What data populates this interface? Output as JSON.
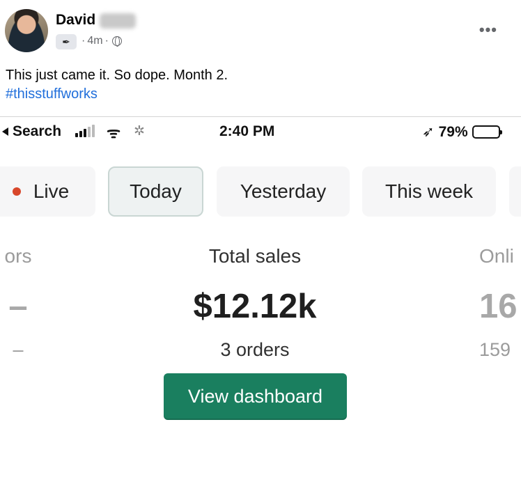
{
  "post": {
    "author": "David",
    "time": "4m",
    "separator": "·",
    "text": "This just came it. So dope. Month 2.",
    "hashtag": "#thisstuffworks",
    "more": "•••"
  },
  "phone": {
    "status": {
      "back_label": "Search",
      "time": "2:40 PM",
      "battery": "79%",
      "battery_level": 0.79
    },
    "tabs": [
      {
        "label": "Live"
      },
      {
        "label": "Today"
      },
      {
        "label": "Yesterday"
      },
      {
        "label": "This week"
      }
    ],
    "metrics": {
      "left": {
        "label": "ors",
        "value": "–",
        "sub": "–"
      },
      "center": {
        "label": "Total sales",
        "value": "$12.12k",
        "sub": "3 orders"
      },
      "right": {
        "label": "Onli",
        "value": "16",
        "sub": "159"
      }
    },
    "cta": "View dashboard"
  },
  "colors": {
    "hashtag": "#216fdb",
    "live_dot": "#d8472b",
    "cta_background": "#1a7f5f"
  }
}
